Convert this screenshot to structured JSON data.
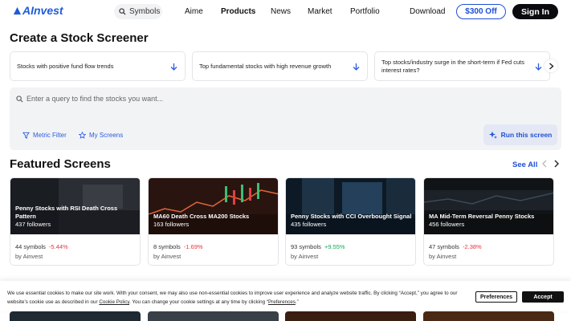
{
  "header": {
    "logo_text": "AInvest",
    "search_placeholder": "Symbols",
    "nav": [
      {
        "label": "Aime"
      },
      {
        "label": "Products"
      },
      {
        "label": "News"
      },
      {
        "label": "Market"
      },
      {
        "label": "Portfolio"
      },
      {
        "label": "Download"
      }
    ],
    "promo_button": "$300 Off",
    "signin_button": "Sign In"
  },
  "page_title": "Create a Stock Screener",
  "suggestions": [
    {
      "text": "Stocks with positive fund flow trends"
    },
    {
      "text": "Top fundamental stocks with high revenue growth"
    },
    {
      "text": "Top stocks/industry surge in the short-term if Fed cuts interest rates?"
    }
  ],
  "query": {
    "placeholder": "Enter a query to find the stocks you want...",
    "metric_filter": "Metric Filter",
    "my_screens": "My Screens",
    "run_button": "Run this screen"
  },
  "featured": {
    "title": "Featured Screens",
    "see_all": "See All",
    "cards": [
      {
        "title": "Penny Stocks with RSI Death Cross Pattern",
        "followers": "437 followers",
        "symbols": "44 symbols",
        "change": "-5.44%",
        "by": "by Ainvest"
      },
      {
        "title": "MA60 Death Cross MA200 Stocks",
        "followers": "163 followers",
        "symbols": "8 symbols",
        "change": "-1.69%",
        "by": "by Ainvest"
      },
      {
        "title": "Penny Stocks with CCI Overbought Signal",
        "followers": "435 followers",
        "symbols": "93 symbols",
        "change": "+9.55%",
        "by": "by Ainvest"
      },
      {
        "title": "MA Mid-Term Reversal Penny Stocks",
        "followers": "456 followers",
        "symbols": "47 symbols",
        "change": "-2.38%",
        "by": "by Ainvest"
      }
    ]
  },
  "cookie": {
    "text_1": "We use essential cookies to make our site work. With your consent, we may also use non-essential cookies to improve user experience and analyze website traffic. By clicking “Accept,” you agree to our website’s cookie use as described in our ",
    "policy_link": "Cookie Policy",
    "text_2": ". You can change your cookie settings at any time by clicking “",
    "prefs_link": "Preferences",
    "text_3": ".”",
    "preferences_button": "Preferences",
    "accept_button": "Accept"
  },
  "colors": {
    "accent": "#1f4fd6",
    "negative": "#e0383e",
    "positive": "#1aa75a"
  }
}
